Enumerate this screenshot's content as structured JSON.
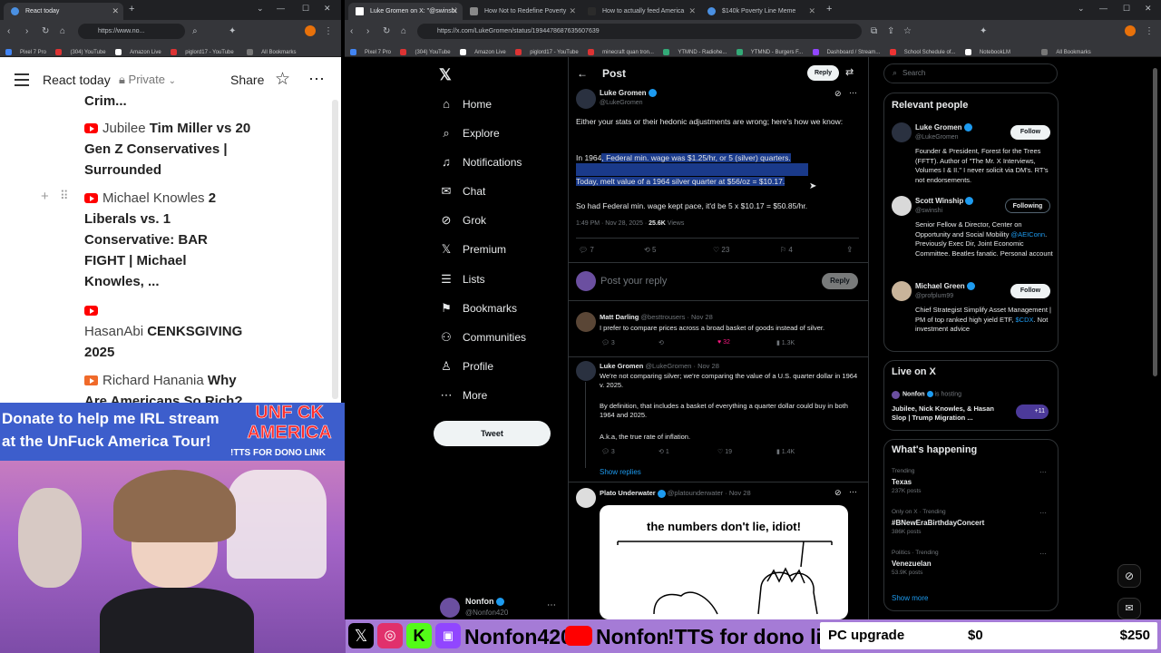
{
  "left_browser": {
    "tabs": [
      {
        "title": "React today",
        "active": true
      },
      {
        "title": "+",
        "active": false
      }
    ],
    "url": "https://www.no...",
    "bookmarks": [
      "Pixel 7 Pro",
      "(304) YouTube",
      "Amazon Live",
      "piglord17 - YouTube",
      "All Bookmarks"
    ]
  },
  "notebook": {
    "menu_icon": "hamburger-icon",
    "title": "React today",
    "privacy": "Private",
    "share_label": "Share",
    "star_icon": "star-icon",
    "more_icon": "more-dots-icon",
    "items": [
      {
        "title": "Crim..."
      },
      {
        "channel": "Jubilee",
        "title": "Tim Miller vs 20 Gen Z Conservatives | Surrounded"
      },
      {
        "channel": "Michael Knowles",
        "title": "2 Liberals vs. 1 Conservative: BAR FIGHT | Michael Knowles, ..."
      },
      {
        "channel": "HasanAbi",
        "title": "CENKSGIVING 2025"
      },
      {
        "channel": "Richard Hanania",
        "title": "Why Are Americans So Rich?"
      }
    ]
  },
  "stream_overlay": {
    "donate_line1": "Donate to help me  IRL stream",
    "donate_line2": "at the UnFuck America Tour!",
    "logo_line1": "UNF CK",
    "logo_line2": "AMERICA",
    "tts_label": "!TTS FOR DONO LINK",
    "handle_twitch": "Nonfon420",
    "handle_youtube": "Nonfon",
    "tts_bottom": "!TTS for dono link",
    "goal_label": "PC upgrade",
    "goal_current": "$0",
    "goal_target": "$250",
    "goal_progress": 0
  },
  "right_browser": {
    "tabs": [
      {
        "title": "Luke Gromen on X: \"@swinshi",
        "active": true
      },
      {
        "title": "How Not to Redefine Poverty",
        "active": false
      },
      {
        "title": "How to actually feed America",
        "active": false
      },
      {
        "title": "$140k Poverty Line Meme",
        "active": false
      }
    ],
    "url": "https://x.com/LukeGromen/status/1994478687635607639",
    "bookmarks": [
      "Pixel 7 Pro",
      "(304) YouTube",
      "Amazon Live",
      "piglord17 - YouTube",
      "minecraft quan tron...",
      "YTMND - Radiohe...",
      "YTMND - Burgers F...",
      "Dashboard / Stream...",
      "School Schedule of...",
      "NotebookLM",
      "All Bookmarks"
    ]
  },
  "x": {
    "nav": [
      {
        "label": "Home",
        "icon": "home-icon",
        "glyph": "⌂"
      },
      {
        "label": "Explore",
        "icon": "search-icon",
        "glyph": "⌕"
      },
      {
        "label": "Notifications",
        "icon": "bell-icon",
        "glyph": "♫"
      },
      {
        "label": "Chat",
        "icon": "mail-icon",
        "glyph": "✉"
      },
      {
        "label": "Grok",
        "icon": "grok-icon",
        "glyph": "⊘"
      },
      {
        "label": "Premium",
        "icon": "x-logo-icon",
        "glyph": "𝕏"
      },
      {
        "label": "Lists",
        "icon": "list-icon",
        "glyph": "☰"
      },
      {
        "label": "Bookmarks",
        "icon": "bookmark-icon",
        "glyph": "⚑"
      },
      {
        "label": "Communities",
        "icon": "people-icon",
        "glyph": "⚇"
      },
      {
        "label": "Profile",
        "icon": "person-icon",
        "glyph": "♙"
      },
      {
        "label": "More",
        "icon": "more-circle-icon",
        "glyph": "⋯"
      }
    ],
    "tweet_button": "Tweet",
    "account": {
      "name": "Nonfon",
      "handle": "@Nonfon420"
    },
    "header_title": "Post",
    "reply_button": "Reply",
    "post": {
      "author": "Luke Gromen",
      "handle": "@LukeGromen",
      "text1": "Either your stats or their hedonic adjustments are wrong; here's how we know:",
      "text2a": "In 1964",
      "text2b": ", Federal min. wage was $1.25/hr, or 5 (silver) quarters.",
      "text3": "Today, melt value of a 1964 silver quarter at $56/oz = $10.17.",
      "text4": "So had Federal min. wage kept pace, it'd be 5 x $10.17 = $50.85/hr.",
      "time": "1:49 PM · Nov 28, 2025 · ",
      "views": "25.6K",
      "views_label": " Views",
      "replies": "7",
      "reposts": "5",
      "likes": "23",
      "bookmarks": "4"
    },
    "composer_placeholder": "Post your reply",
    "composer_button": "Reply",
    "replies": [
      {
        "author": "Matt Darling",
        "handle": "@besttrousers",
        "date": "· Nov 28",
        "text": "I prefer to compare prices across a broad  basket of goods instead of silver.",
        "replies": "3",
        "reposts": "",
        "likes": "32",
        "views": "1.3K"
      },
      {
        "author": "Luke Gromen",
        "handle": "@LukeGromen",
        "date": "· Nov 28",
        "text": "We're not comparing silver; we're comparing the value of a U.S. quarter dollar in 1964 v. 2025.",
        "text2": "By definition, that includes a basket of everything a quarter dollar could buy in both 1964 and 2025.",
        "text3": "A.k.a, the true rate of inflation.",
        "replies": "3",
        "reposts": "1",
        "likes": "19",
        "views": "1.4K"
      },
      {
        "author": "Plato Underwater",
        "handle": "@platounderwater",
        "date": "· Nov 28",
        "comic": "the numbers don't lie, idiot!"
      }
    ],
    "show_replies": "Show replies",
    "search_placeholder": "Search",
    "relevant_title": "Relevant people",
    "people": [
      {
        "name": "Luke Gromen",
        "handle": "@LukeGromen",
        "button": "Follow",
        "bio": "Founder & President, Forest for the Trees (FFTT). Author of \"The Mr. X Interviews, Volumes I & II.\" I never solicit via DM's. RT's not endorsements."
      },
      {
        "name": "Scott Winship",
        "handle": "@swinshi",
        "button": "Following",
        "bio": "Senior Fellow & Director, Center on Opportunity and Social Mobility ",
        "bio_link": "@AEIConn",
        "bio_rest": ". Previously Exec Dir, Joint Economic Committee. Beatles fanatic. Personal account"
      },
      {
        "name": "Michael Green",
        "handle": "@profplum99",
        "button": "Follow",
        "bio": "Chief Strategist Simplify Asset Management | PM of top ranked high yield ETF, ",
        "bio_link": "$CDX",
        "bio_rest": ". Not investment advice"
      }
    ],
    "live_title": "Live on X",
    "live": {
      "host": "Nonfon",
      "hosting": "is hosting",
      "title": "Jubilee, Nick Knowles, & Hasan Slop | Trump Migration ...",
      "count": "+11"
    },
    "happening_title": "What's happening",
    "trends": [
      {
        "context": "Trending",
        "name": "Texas",
        "posts": "237K posts"
      },
      {
        "context": "Only on X · Trending",
        "name": "#BNewEraBirthdayConcert",
        "posts": "386K posts"
      },
      {
        "context": "Politics · Trending",
        "name": "Venezuelan",
        "posts": "53.9K posts"
      }
    ],
    "show_more": "Show more"
  },
  "colors": {
    "x_bg": "#000000",
    "x_blue": "#1d9bf0",
    "highlight": "#1a3a8a",
    "overlay_blue": "#3d5ecc",
    "bottom_bar": "#a57bd6"
  }
}
